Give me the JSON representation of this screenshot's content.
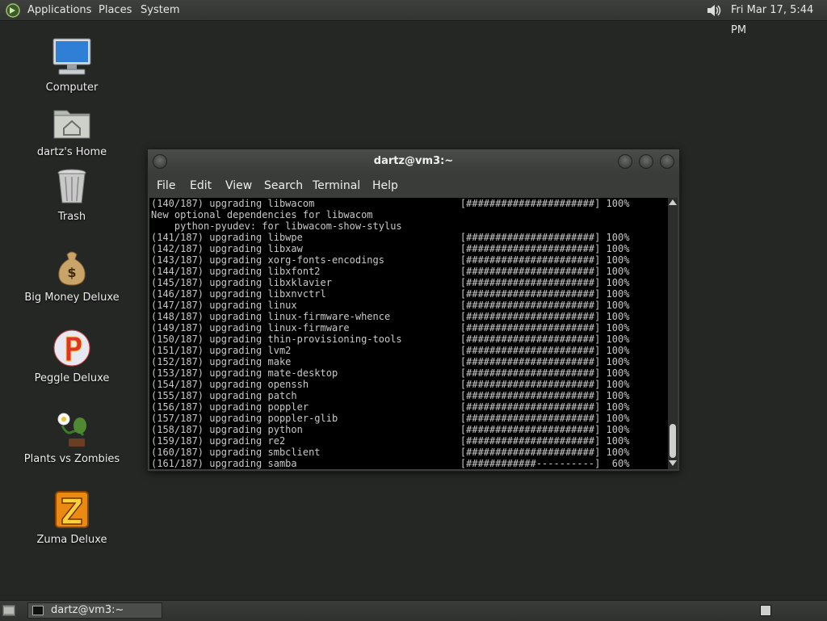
{
  "top_panel": {
    "menus": [
      "Applications",
      "Places",
      "System"
    ],
    "clock": "Fri Mar 17,  5:44 PM"
  },
  "desktop_icons": [
    {
      "label": "Computer",
      "icon": "computer-icon"
    },
    {
      "label": "dartz's Home",
      "icon": "home-folder-icon"
    },
    {
      "label": "Trash",
      "icon": "trash-icon"
    },
    {
      "label": "Big Money Deluxe",
      "icon": "money-bag-icon"
    },
    {
      "label": "Peggle Deluxe",
      "icon": "peggle-icon"
    },
    {
      "label": "Plants vs Zombies",
      "icon": "plants-vs-zombies-icon"
    },
    {
      "label": "Zuma Deluxe",
      "icon": "zuma-icon"
    }
  ],
  "terminal": {
    "title": "dartz@vm3:~",
    "menus": [
      "File",
      "Edit",
      "View",
      "Search",
      "Terminal",
      "Help"
    ],
    "lines": [
      "(140/187) upgrading libwacom                         [######################] 100%",
      "New optional dependencies for libwacom",
      "    python-pyudev: for libwacom-show-stylus",
      "(141/187) upgrading libwpe                           [######################] 100%",
      "(142/187) upgrading libxaw                           [######################] 100%",
      "(143/187) upgrading xorg-fonts-encodings             [######################] 100%",
      "(144/187) upgrading libxfont2                        [######################] 100%",
      "(145/187) upgrading libxklavier                      [######################] 100%",
      "(146/187) upgrading libxnvctrl                       [######################] 100%",
      "(147/187) upgrading linux                            [######################] 100%",
      "(148/187) upgrading linux-firmware-whence            [######################] 100%",
      "(149/187) upgrading linux-firmware                   [######################] 100%",
      "(150/187) upgrading thin-provisioning-tools          [######################] 100%",
      "(151/187) upgrading lvm2                             [######################] 100%",
      "(152/187) upgrading make                             [######################] 100%",
      "(153/187) upgrading mate-desktop                     [######################] 100%",
      "(154/187) upgrading openssh                          [######################] 100%",
      "(155/187) upgrading patch                            [######################] 100%",
      "(156/187) upgrading poppler                          [######################] 100%",
      "(157/187) upgrading poppler-glib                     [######################] 100%",
      "(158/187) upgrading python                           [######################] 100%",
      "(159/187) upgrading re2                              [######################] 100%",
      "(160/187) upgrading smbclient                        [######################] 100%",
      "(161/187) upgrading samba                            [############----------]  60%"
    ]
  },
  "taskbar": {
    "task_label": "dartz@vm3:~"
  },
  "colors": {
    "desktop": "#252725",
    "panel": "#383a38",
    "terminal_bg": "#000000",
    "terminal_fg": "#c8c8c8"
  }
}
